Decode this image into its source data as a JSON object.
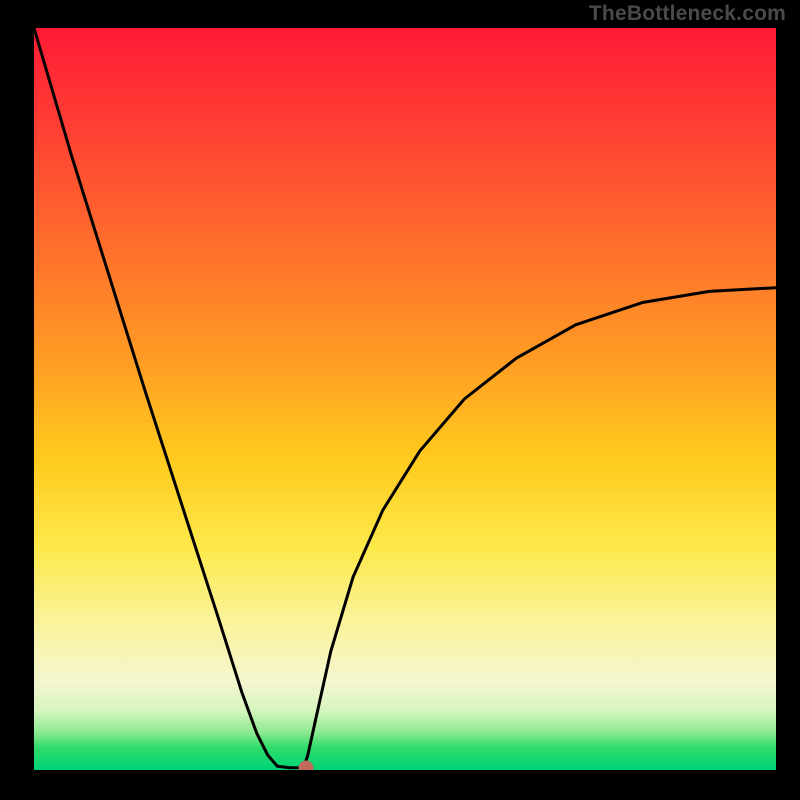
{
  "watermark": "TheBottleneck.com",
  "chart_data": {
    "type": "line",
    "title": "",
    "xlabel": "",
    "ylabel": "",
    "xlim": [
      0,
      100
    ],
    "ylim": [
      0,
      100
    ],
    "series": [
      {
        "name": "curve",
        "x": [
          0,
          5,
          10,
          15,
          20,
          25,
          28,
          30,
          31.5,
          32.8,
          34.5,
          35.8,
          36.4,
          36.9,
          38,
          40,
          43,
          47,
          52,
          58,
          65,
          73,
          82,
          91,
          100
        ],
        "y": [
          100,
          83,
          67,
          51,
          35.5,
          20,
          10.5,
          5,
          2,
          0.5,
          0.3,
          0.3,
          0.5,
          2,
          7,
          16,
          26,
          35,
          43,
          50,
          55.5,
          60,
          63,
          64.5,
          65
        ]
      }
    ],
    "marker": {
      "x": 36.6,
      "y": 0.3
    },
    "grid": false,
    "legend": false
  }
}
